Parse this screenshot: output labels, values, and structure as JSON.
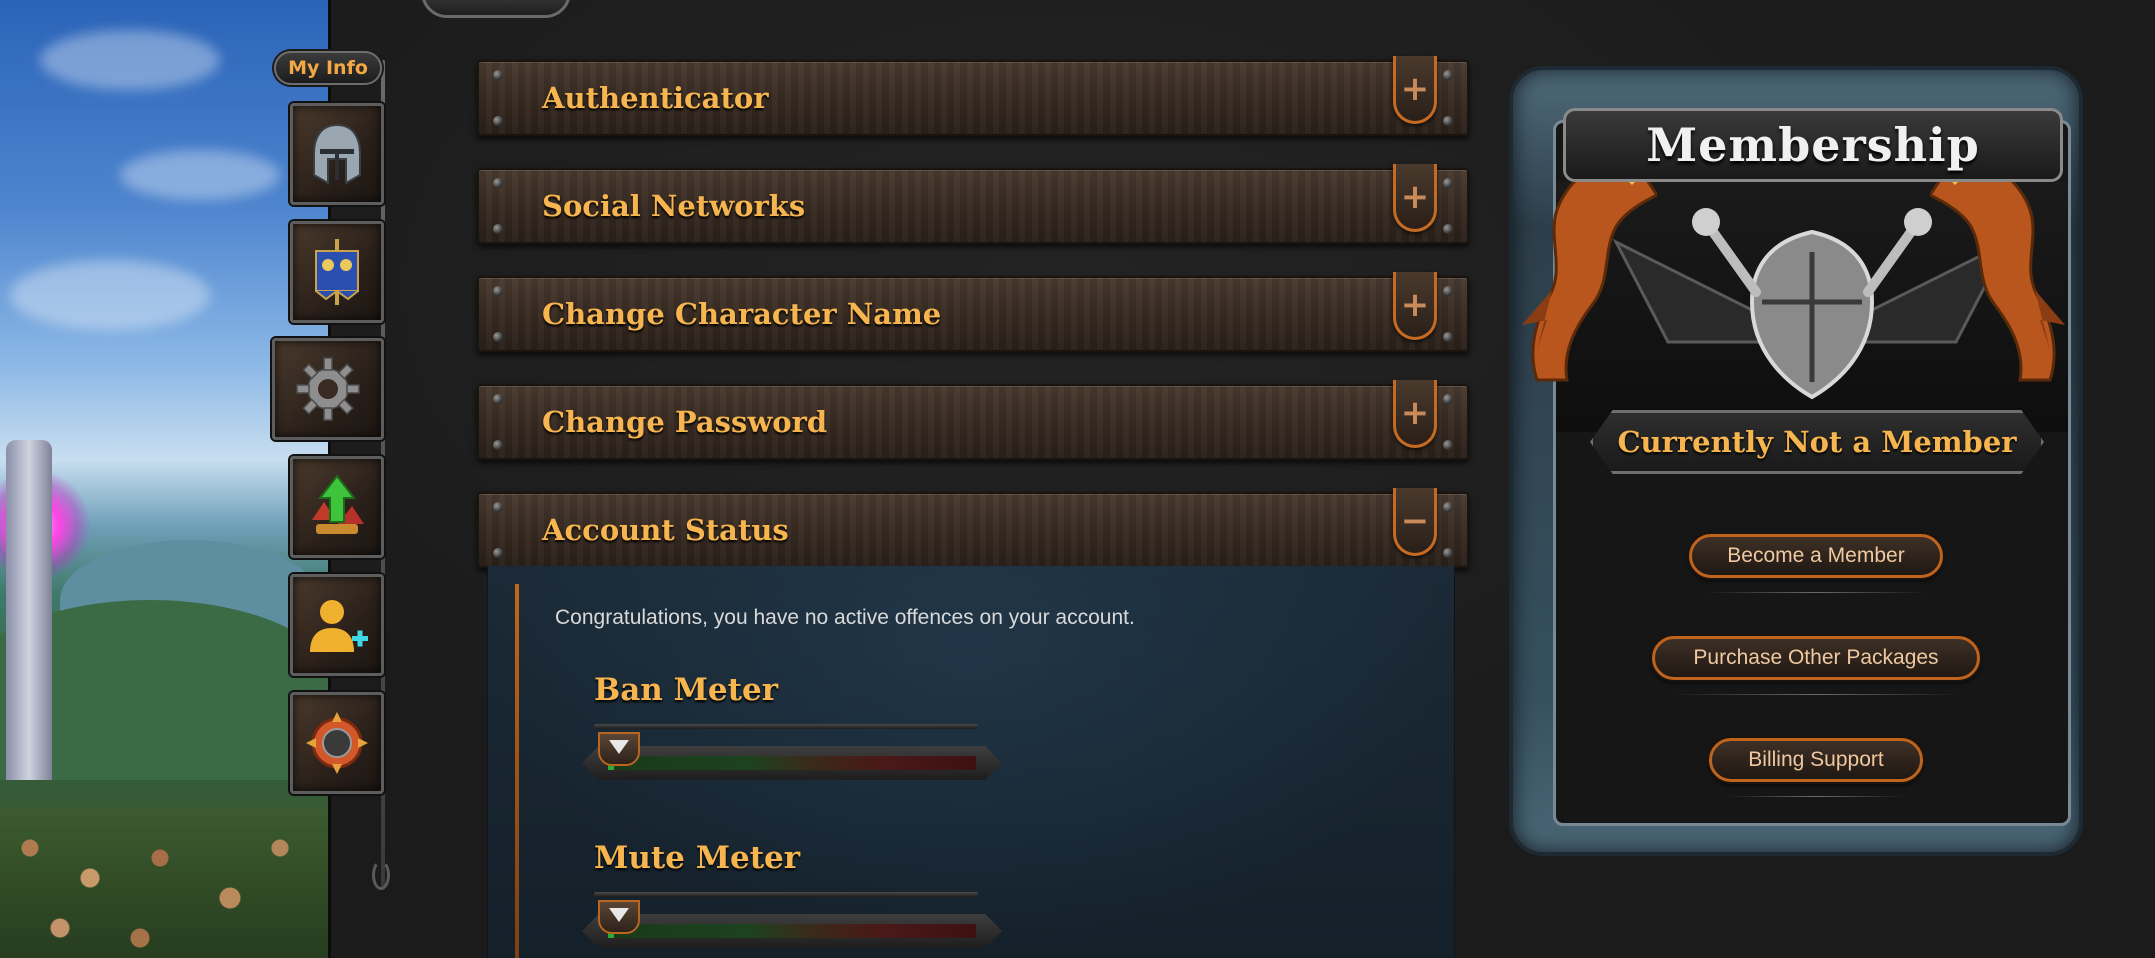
{
  "sidebar": {
    "my_info_label": "My Info",
    "icons": [
      "helmet-icon",
      "banner-icon",
      "gear-icon",
      "upgrade-arrow-icon",
      "add-friend-icon",
      "gem-emblem-icon"
    ]
  },
  "accordion": {
    "sections": [
      {
        "title": "Authenticator",
        "toggle": "+"
      },
      {
        "title": "Social Networks",
        "toggle": "+"
      },
      {
        "title": "Change Character Name",
        "toggle": "+"
      },
      {
        "title": "Change Password",
        "toggle": "+"
      },
      {
        "title": "Account Status",
        "toggle": "−"
      }
    ]
  },
  "account_status": {
    "message": "Congratulations, you have no active offences on your account.",
    "ban_meter": {
      "label": "Ban Meter",
      "level": 0
    },
    "mute_meter": {
      "label": "Mute Meter",
      "level": 0
    }
  },
  "membership": {
    "title": "Membership",
    "status": "Currently Not a Member",
    "buttons": {
      "become_member": "Become a Member",
      "purchase_packages": "Purchase Other Packages",
      "billing_support": "Billing Support"
    }
  },
  "colors": {
    "accent_gold": "#f6b54e",
    "accent_orange": "#c0631c",
    "panel_dark": "#1b1b1b",
    "status_blue": "#1b2a36"
  }
}
